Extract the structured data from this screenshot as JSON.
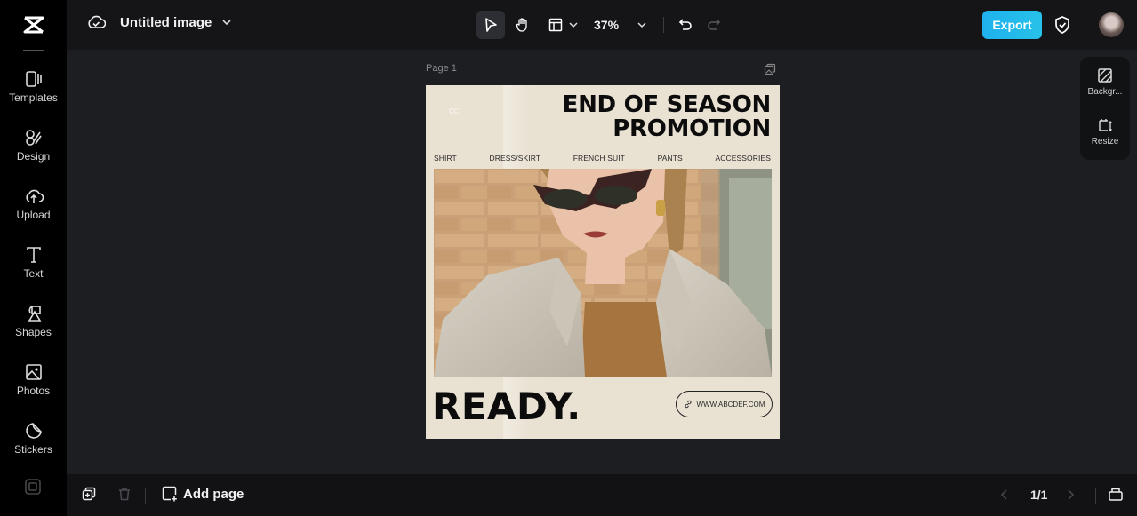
{
  "header": {
    "title": "Untitled image",
    "zoom": "37%",
    "export_label": "Export"
  },
  "sidebar": {
    "items": [
      {
        "label": "Templates",
        "icon": "templates-icon"
      },
      {
        "label": "Design",
        "icon": "design-icon"
      },
      {
        "label": "Upload",
        "icon": "upload-icon"
      },
      {
        "label": "Text",
        "icon": "text-icon"
      },
      {
        "label": "Shapes",
        "icon": "shapes-icon"
      },
      {
        "label": "Photos",
        "icon": "photos-icon"
      },
      {
        "label": "Stickers",
        "icon": "stickers-icon"
      }
    ]
  },
  "canvas": {
    "page_label": "Page 1",
    "poster": {
      "corner_mark": "CC",
      "headline_line1": "END OF SEASON",
      "headline_line2": "PROMOTION",
      "categories": [
        "SHIRT",
        "DRESS/SKIRT",
        "FRENCH SUIT",
        "PANTS",
        "ACCESSORIES"
      ],
      "tagline": "READY.",
      "url": "WWW.ABCDEF.COM",
      "background_color": "#e9e1d2"
    }
  },
  "right_panel": {
    "items": [
      {
        "label": "Backgr...",
        "icon": "background-icon"
      },
      {
        "label": "Resize",
        "icon": "resize-icon"
      }
    ]
  },
  "footer": {
    "add_page_label": "Add page",
    "pager": "1/1"
  },
  "colors": {
    "accent": "#1fb1ee"
  }
}
